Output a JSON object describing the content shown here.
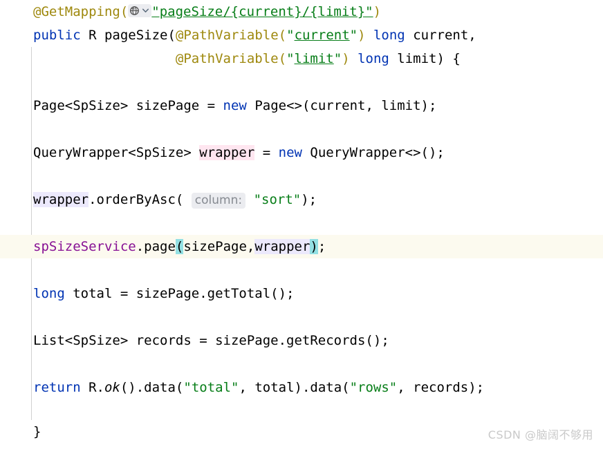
{
  "editor": {
    "language": "java",
    "background_color": "#ffffff",
    "current_line_color": "#fcfaef",
    "indent_guide_color": "#d0d0d0",
    "colors": {
      "keyword": "#0033b3",
      "annotation": "#9e880d",
      "string": "#067d17",
      "identifier": "#000000",
      "field_reference": "#871094",
      "inlay_hint_text": "#868a91",
      "inlay_hint_background": "#ebecf0",
      "write_occurrence_highlight": "#ffe6f0",
      "read_occurrence_highlight": "#ece9fc",
      "matched_bracket_highlight": "#93e0e3"
    },
    "gutter_icon": {
      "name": "globe-icon",
      "has_chevron": true,
      "tooltip_label": "@GetMapping"
    },
    "lines": [
      {
        "n": 1,
        "indent": 0,
        "current": false,
        "text": "@GetMapping(\"pageSize/{current}/{limit}\")"
      },
      {
        "n": 2,
        "indent": 0,
        "current": false,
        "text": "public R pageSize(@PathVariable(\"current\") long current,"
      },
      {
        "n": 3,
        "indent": 0,
        "current": false,
        "text": "                  @PathVariable(\"limit\") long limit) {"
      },
      {
        "n": 4,
        "indent": 0,
        "current": false,
        "text": ""
      },
      {
        "n": 5,
        "indent": 1,
        "current": false,
        "text": "    Page<SpSize> sizePage = new Page<>(current, limit);"
      },
      {
        "n": 6,
        "indent": 0,
        "current": false,
        "text": ""
      },
      {
        "n": 7,
        "indent": 1,
        "current": false,
        "text": "    QueryWrapper<SpSize> wrapper = new QueryWrapper<>();"
      },
      {
        "n": 8,
        "indent": 0,
        "current": false,
        "text": ""
      },
      {
        "n": 9,
        "indent": 1,
        "current": false,
        "text": "    wrapper.orderByAsc( column: \"sort\");"
      },
      {
        "n": 10,
        "indent": 0,
        "current": false,
        "text": ""
      },
      {
        "n": 11,
        "indent": 1,
        "current": true,
        "text": "    spSizeService.page(sizePage,wrapper);"
      },
      {
        "n": 12,
        "indent": 0,
        "current": false,
        "text": ""
      },
      {
        "n": 13,
        "indent": 1,
        "current": false,
        "text": "    long total = sizePage.getTotal();"
      },
      {
        "n": 14,
        "indent": 0,
        "current": false,
        "text": ""
      },
      {
        "n": 15,
        "indent": 1,
        "current": false,
        "text": "    List<SpSize> records = sizePage.getRecords();"
      },
      {
        "n": 16,
        "indent": 0,
        "current": false,
        "text": ""
      },
      {
        "n": 17,
        "indent": 1,
        "current": false,
        "text": "    return R.ok().data(\"total\", total).data(\"rows\", records);"
      },
      {
        "n": 18,
        "indent": 0,
        "current": false,
        "text": ""
      },
      {
        "n": 19,
        "indent": 0,
        "current": false,
        "text": "}"
      }
    ],
    "tokens": {
      "l1_annotation": "@GetMapping",
      "l1_open_paren": "(",
      "l1_string": "\"pageSize/{current}/{limit}\"",
      "l1_close_paren": ")",
      "l2_public": "public",
      "l2_type": " R ",
      "l2_method": "pageSize",
      "l2_paren_open": "(",
      "l2_anno": "@PathVariable",
      "l2_anno_open": "(",
      "l2_quote_open": "\"",
      "l2_anno_arg": "current",
      "l2_quote_close": "\"",
      "l2_anno_close": ")",
      "l2_long": " long",
      "l2_param": " current,",
      "l3_indent": "                  ",
      "l3_anno": "@PathVariable",
      "l3_anno_open": "(",
      "l3_quote_open": "\"",
      "l3_anno_arg": "limit",
      "l3_quote_close": "\"",
      "l3_anno_close": ")",
      "l3_long": " long",
      "l3_param": " limit) {",
      "l5_pre": "Page<SpSize> sizePage = ",
      "l5_new": "new",
      "l5_post": " Page<>(current, limit);",
      "l7_pre": "QueryWrapper<SpSize> ",
      "l7_var": "wrapper",
      "l7_mid": " = ",
      "l7_new": "new",
      "l7_post": " QueryWrapper<>();",
      "l9_var": "wrapper",
      "l9_mid": ".orderByAsc( ",
      "l9_hint": "column:",
      "l9_space": " ",
      "l9_str": "\"sort\"",
      "l9_end": ");",
      "l11_field": "spSizeService",
      "l11_method": ".page",
      "l11_paren_open": "(",
      "l11_arg1": "sizePage,",
      "l11_arg2": "wrapper",
      "l11_paren_close": ")",
      "l11_semi": ";",
      "l13_long": "long",
      "l13_rest": " total = sizePage.getTotal();",
      "l15_text": "List<SpSize> records = sizePage.getRecords();",
      "l17_return": "return",
      "l17_a": " R.",
      "l17_ok": "ok",
      "l17_b": "().data(",
      "l17_s1": "\"total\"",
      "l17_c": ", total).data(",
      "l17_s2": "\"rows\"",
      "l17_d": ", records);",
      "l19_brace": "}"
    }
  },
  "watermark": {
    "text": "CSDN @脑阔不够用"
  }
}
